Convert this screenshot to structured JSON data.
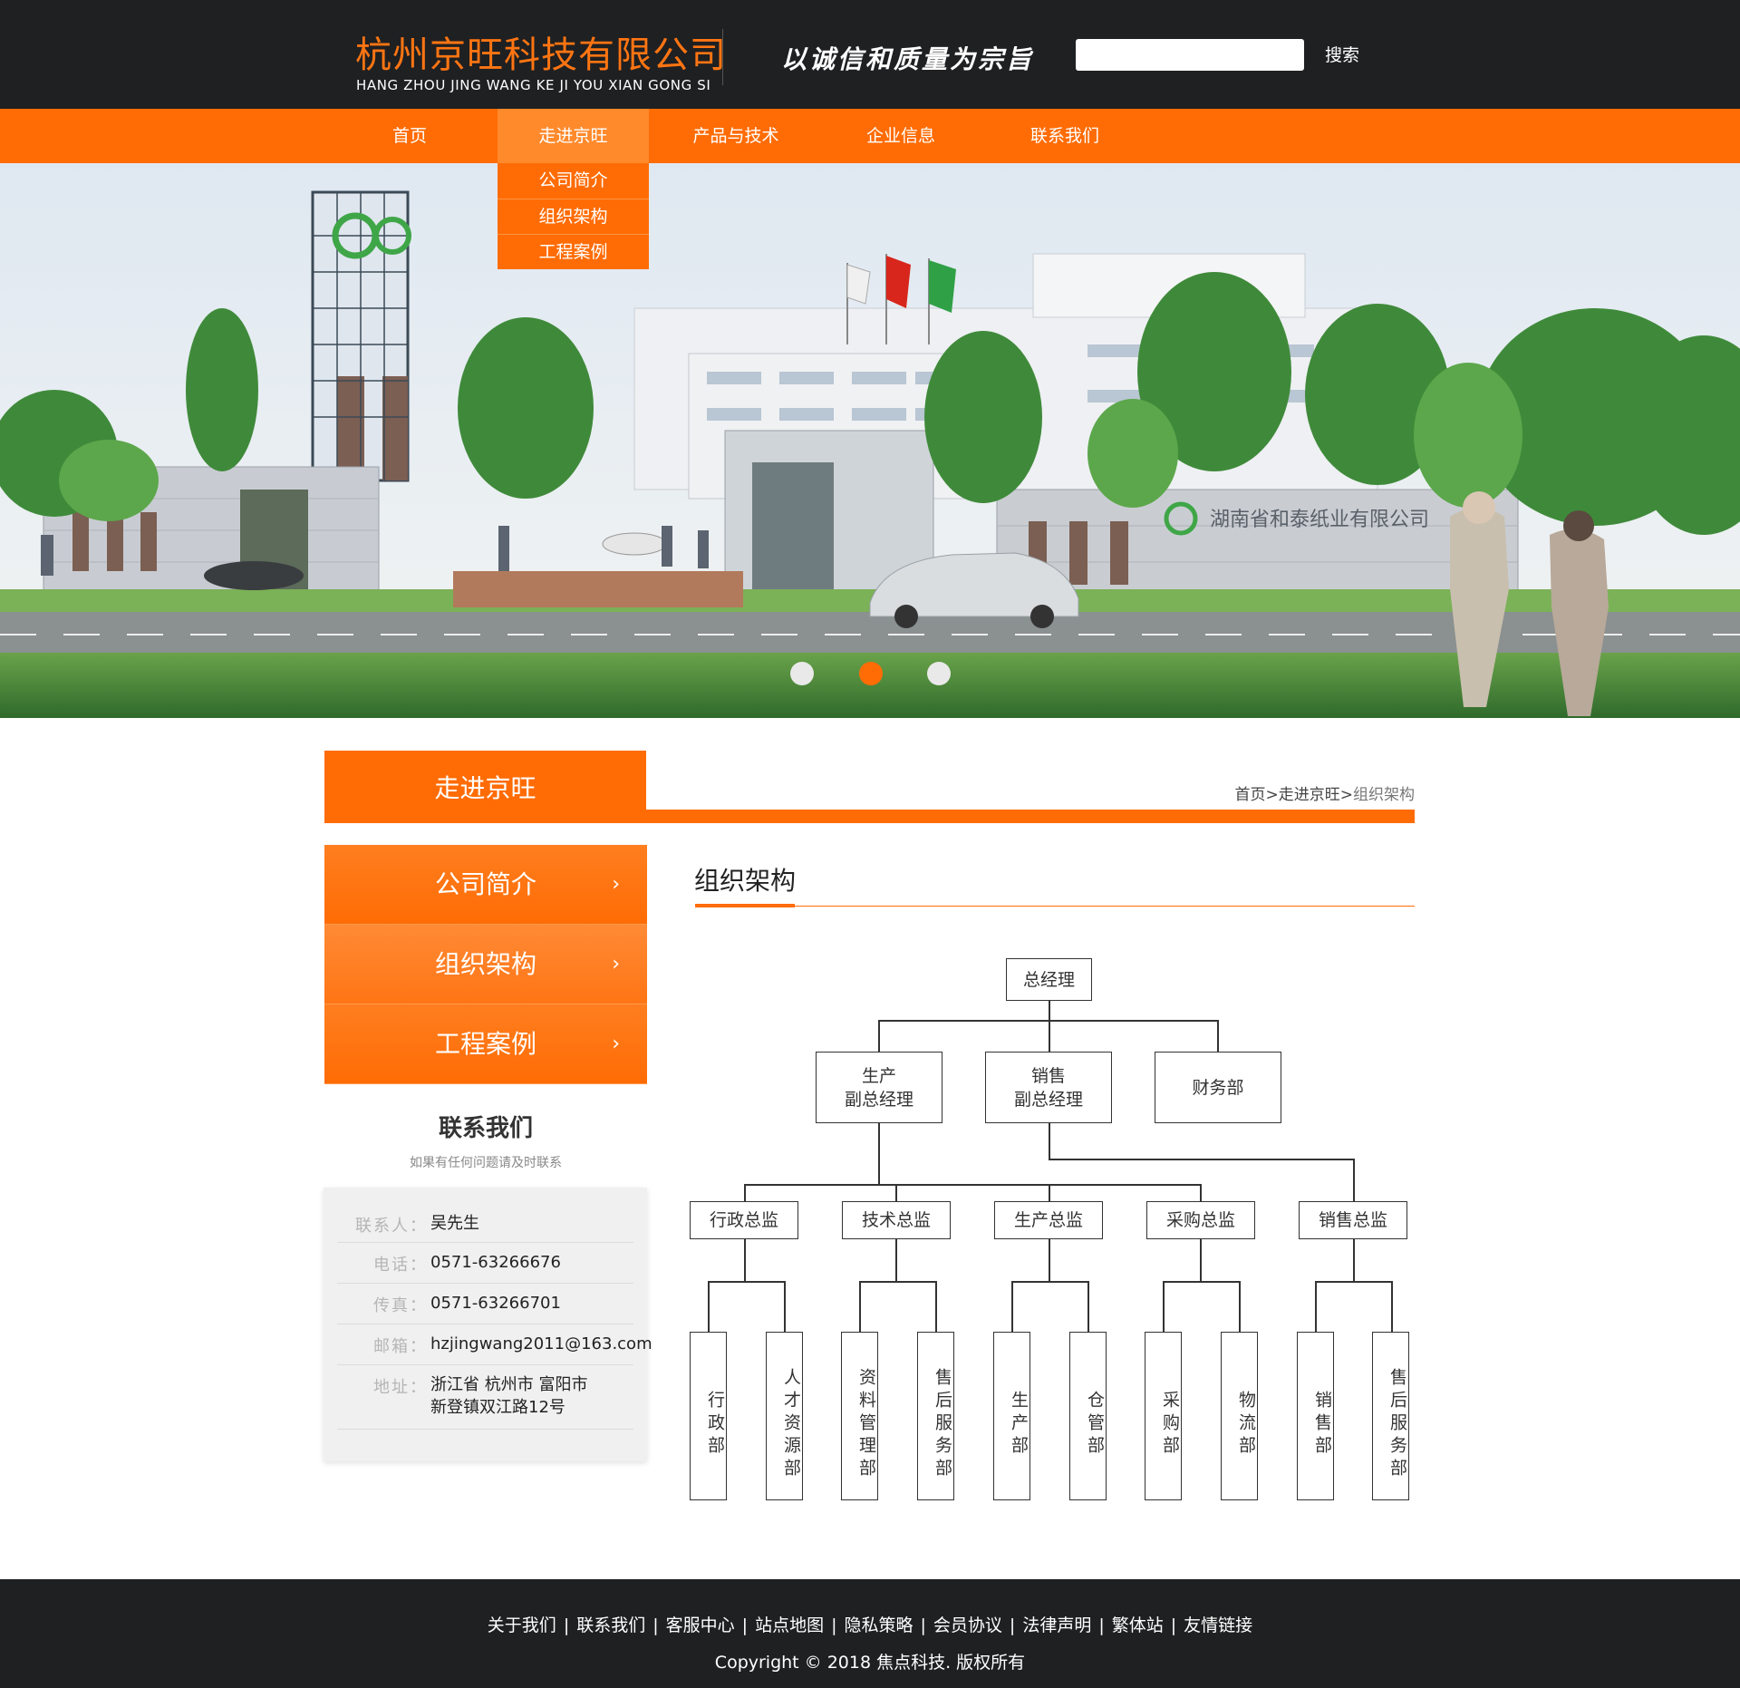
{
  "header": {
    "company_name": "杭州京旺科技有限公司",
    "company_pinyin": "HANG ZHOU JING WANG KE JI YOU XIAN GONG SI",
    "slogan": "以诚信和质量为宗旨",
    "search_placeholder": "",
    "search_label": "搜索"
  },
  "nav": {
    "items": [
      "首页",
      "走进京旺",
      "产品与技术",
      "企业信息",
      "联系我们"
    ],
    "active_index": 1,
    "dropdown": [
      "公司简介",
      "组织架构",
      "工程案例"
    ]
  },
  "banner": {
    "sign_text": "湖南省和泰纸业有限公司",
    "slide_count": 3,
    "active_slide": 1
  },
  "section": {
    "title": "走进京旺",
    "breadcrumb": [
      "首页",
      "走进京旺",
      "组织架构"
    ],
    "breadcrumb_separator": ">"
  },
  "sidebar": {
    "items": [
      "公司简介",
      "组织架构",
      "工程案例"
    ],
    "active_index": 1,
    "arrow": "›"
  },
  "contact": {
    "title": "联系我们",
    "subtitle": "如果有任何问题请及时联系",
    "rows": [
      {
        "label": "联系人",
        "value": "吴先生"
      },
      {
        "label": "电话",
        "value": "0571-63266676"
      },
      {
        "label": "传真",
        "value": "0571-63266701"
      },
      {
        "label": "邮箱",
        "value": "hzjingwang2011@163.com"
      },
      {
        "label": "地址",
        "value": "浙江省 杭州市 富阳市",
        "value2": "新登镇双江路12号"
      }
    ],
    "colon": "："
  },
  "org_chart": {
    "title": "组织架构",
    "root": "总经理",
    "level2": [
      {
        "line1": "生产",
        "line2": "副总经理"
      },
      {
        "line1": "销售",
        "line2": "副总经理"
      },
      {
        "line1": "财务部",
        "line2": ""
      }
    ],
    "directors": [
      "行政总监",
      "技术总监",
      "生产总监",
      "采购总监",
      "销售总监"
    ],
    "departments": [
      "行政部",
      "人才资源部",
      "资料管理部",
      "售后服务部",
      "生产部",
      "仓管部",
      "采购部",
      "物流部",
      "销售部",
      "售后服务部"
    ]
  },
  "footer": {
    "links": [
      "关于我们",
      "联系我们",
      "客服中心",
      "站点地图",
      "隐私策略",
      "会员协议",
      "法律声明",
      "繁体站",
      "友情链接"
    ],
    "separator": "|",
    "copyright": "Copyright © 2018 焦点科技. 版权所有"
  },
  "colors": {
    "accent": "#ff6c05",
    "dark": "#1f2022"
  }
}
